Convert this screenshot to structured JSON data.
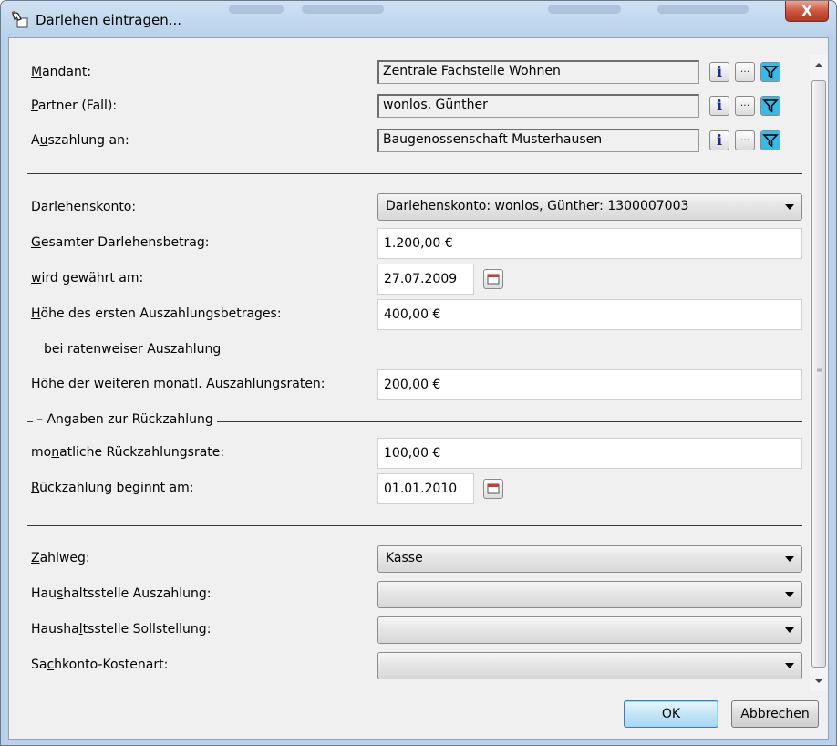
{
  "window": {
    "title": "Darlehen eintragen...",
    "close_glyph": "X"
  },
  "fields": {
    "mandant": {
      "label_pre": "",
      "label_u": "M",
      "label_post": "andant:",
      "value": "Zentrale Fachstelle Wohnen"
    },
    "partner": {
      "label_pre": "",
      "label_u": "P",
      "label_post": "artner (Fall):",
      "value": "wonlos, Günther"
    },
    "auszahlung_an": {
      "label_pre": "A",
      "label_u": "u",
      "label_post": "szahlung an:",
      "value": "Baugenossenschaft Musterhausen"
    },
    "darlehenskonto": {
      "label_pre": "",
      "label_u": "D",
      "label_post": "arlehenskonto:",
      "value": "Darlehenskonto: wonlos, Günther: 1300007003"
    },
    "gesamtbetrag": {
      "label_pre": "",
      "label_u": "G",
      "label_post": "esamter Darlehensbetrag:",
      "value": "1.200,00 €"
    },
    "gewaehrt_am": {
      "label_pre": "",
      "label_u": "w",
      "label_post": "ird gewährt am:",
      "value": "27.07.2009"
    },
    "erster_betrag": {
      "label_pre": "",
      "label_u": "H",
      "label_post": "öhe des ersten Auszahlungsbetrages:",
      "value": "400,00 €"
    },
    "ratenweise_note": "bei ratenweiser Auszahlung",
    "weitere_raten": {
      "label_pre": "H",
      "label_u": "ö",
      "label_post": "he der weiteren monatl. Auszahlungsraten:",
      "value": "200,00 €"
    },
    "rueckzahlung_group": "Angaben zur Rückzahlung",
    "rueckzahlungsrate": {
      "label_pre": "mo",
      "label_u": "n",
      "label_post": "atliche Rückzahlungsrate:",
      "value": "100,00 €"
    },
    "rueckzahlung_beginn": {
      "label_pre": "",
      "label_u": "R",
      "label_post": "ückzahlung beginnt am:",
      "value": "01.01.2010"
    },
    "zahlweg": {
      "label_pre": "",
      "label_u": "Z",
      "label_post": "ahlweg:",
      "value": "Kasse"
    },
    "hh_auszahlung": {
      "label_pre": "Hau",
      "label_u": "s",
      "label_post": "haltsstelle Auszahlung:",
      "value": ""
    },
    "hh_sollstellung": {
      "label_pre": "Hausha",
      "label_u": "l",
      "label_post": "tsstelle Sollstellung:",
      "value": ""
    },
    "sachkonto": {
      "label_pre": "Sa",
      "label_u": "c",
      "label_post": "hkonto-Kostenart:",
      "value": ""
    }
  },
  "buttons": {
    "ok": "OK",
    "cancel": "Abbrechen",
    "info_glyph": "i",
    "browse_glyph": "..."
  },
  "colors": {
    "filter_icon": "#3ab8e6",
    "info_icon": "#1a2f8a",
    "close_button": "#c9503a"
  }
}
